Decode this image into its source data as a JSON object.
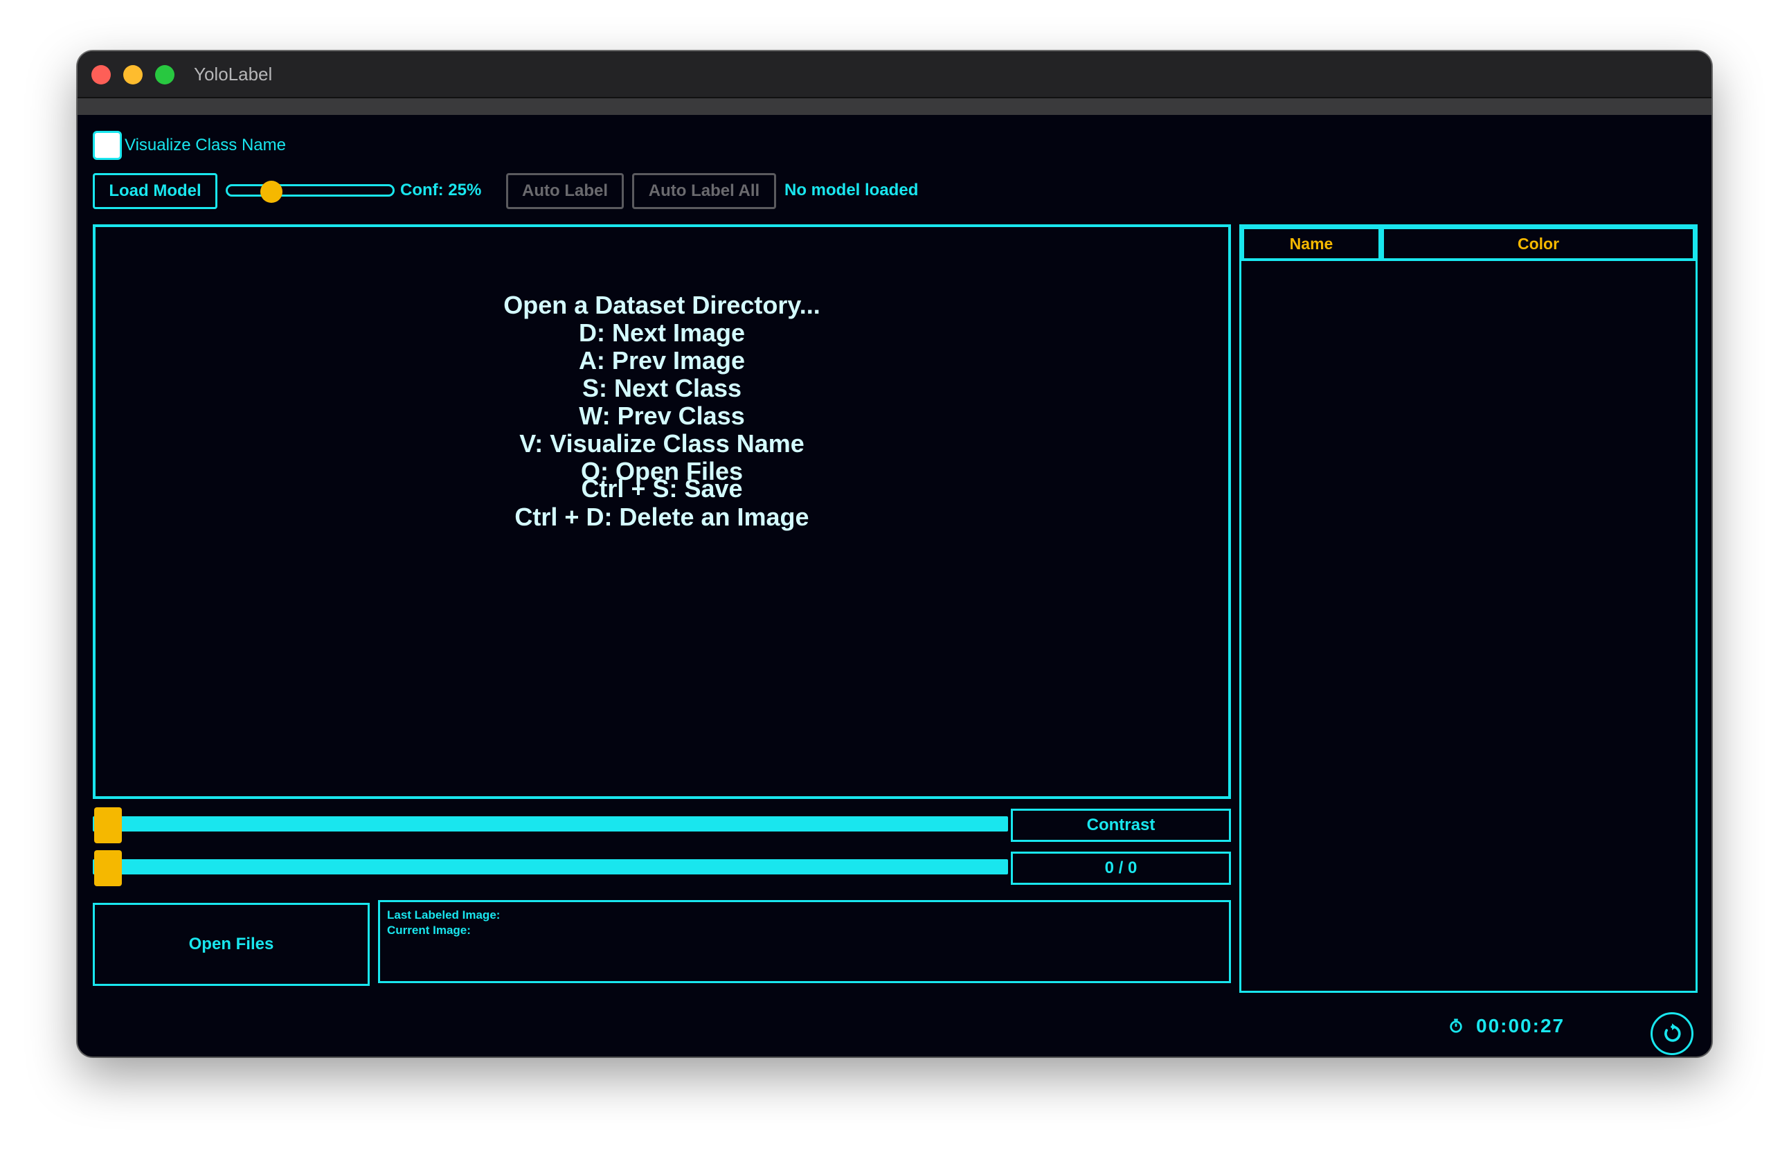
{
  "window": {
    "title": "YoloLabel"
  },
  "options": {
    "visualize_class_name_label": "Visualize Class Name",
    "visualize_checked": false
  },
  "model": {
    "load_label": "Load Model",
    "conf_text": "Conf: 25%",
    "conf_value_percent": 25,
    "auto_label": "Auto Label",
    "auto_label_all": "Auto Label All",
    "status": "No model loaded"
  },
  "help_lines": [
    "Open a Dataset Directory...",
    "D: Next Image",
    "A: Prev Image",
    "S: Next Class",
    "W: Prev Class",
    "V: Visualize Class Name",
    "O: Open Files",
    "Ctrl + S: Save",
    "Ctrl + D: Delete an Image"
  ],
  "sliders": {
    "contrast_label": "Contrast",
    "image_counter": "0 / 0"
  },
  "files": {
    "open_files_label": "Open Files",
    "last_labeled_label": "Last Labeled Image:",
    "current_image_label": "Current Image:"
  },
  "class_table": {
    "columns": [
      "Name",
      "Color"
    ],
    "rows": []
  },
  "footer": {
    "timer": "00:00:27"
  },
  "colors": {
    "accent": "#19e6ee",
    "highlight": "#f5b800",
    "background": "#02030f"
  }
}
